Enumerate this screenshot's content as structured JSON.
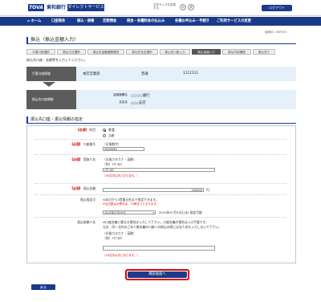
{
  "header": {
    "logo_text": "TOVA",
    "bank_name": "東和銀行",
    "service_name": "ダイレクトサービス",
    "font_size_label": "文字サイズを変更する",
    "font_size_small": "小",
    "font_size_large": "大",
    "logout_label": "ログアウト"
  },
  "nav": {
    "items": [
      "ホーム",
      "口座照会",
      "振込・振替",
      "定期預金",
      "税金・各種料金の払込み",
      "各種お申込み・手続き",
      "ご利用サービスの変更"
    ]
  },
  "screen_no": "画面ID：BKF002",
  "page_title": "振込（振込金額入力）",
  "steps": [
    "引落口座選択",
    "振込方法選択",
    "振込先金融機関選択",
    "振込先支店選択",
    "振込先口座入力",
    "振込金額入力",
    "振込内容確認",
    "振込完了"
  ],
  "instruction": "振込先口座・金額等を入力してください。",
  "withdrawal": {
    "label": "引落口座情報",
    "branch": "本店営業部",
    "type": "普通",
    "number": "1111111"
  },
  "payee": {
    "label": "振込先口座情報",
    "bank_label": "金融機関名",
    "bank_value": "○○○○銀行",
    "branch_label": "支店名",
    "branch_value": "△△△支店"
  },
  "section_title": "振込先口座・振込情報の指定",
  "form": {
    "required_tag": "【必須】",
    "subject": {
      "label": "科目",
      "options": [
        "普通",
        "当座"
      ]
    },
    "account_no": {
      "label": "口座番号",
      "hint": "（半角数字）",
      "value": "9999999"
    },
    "payee_name": {
      "label": "受取人名",
      "hint": "（半角カタカナ・英数）",
      "example": "（例）ﾄｳﾜ ﾀﾛｳ",
      "value": "ﾄｳﾜ ﾀﾛｳ",
      "limit": "（30文字以内となります。）"
    },
    "amount": {
      "label": "振込金額",
      "value": "100000",
      "unit": "円"
    },
    "date": {
      "label": "振込指定日",
      "note1": "※本日から3営業日先まで指定できます。",
      "note2": "※当日振込の受付は、15時までとなります。",
      "date_value": "2015年07月29日",
      "date_text": "2015年07月29日(水) 指定可能"
    },
    "requester": {
      "label": "振込依頼人名",
      "note1": "※口座名義と異なる場合は入力して下さい。口座名義の場合は入力不要です。",
      "note2": "なお、同一法内のご本人様名義の口座への振込の際には法人名を入力しないで下さい。",
      "hint": "（半角カタカナ・英数）",
      "example": "（例）ﾄｳﾜ ﾀﾛｳ",
      "limit": "（20文字以内となります。）"
    }
  },
  "confirm_label": "確認画面へ",
  "back_label": "戻る"
}
